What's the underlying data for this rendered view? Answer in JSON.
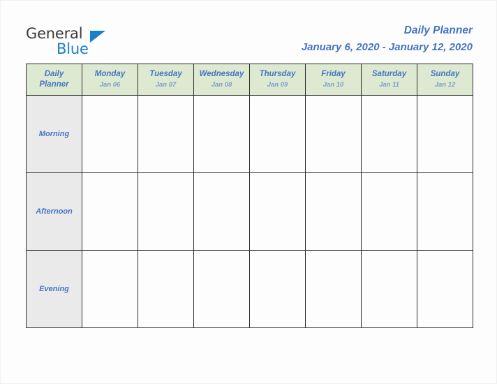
{
  "brand": {
    "line1": "General",
    "line2": "Blue",
    "triangle_icon": "blue-triangle-icon",
    "colors": {
      "text": "#3b3b3b",
      "accent": "#1a7fc8"
    }
  },
  "header": {
    "title": "Daily Planner",
    "date_range": "January 6, 2020 - January 12, 2020",
    "color": "#4574C4"
  },
  "planner": {
    "corner_label_line1": "Daily",
    "corner_label_line2": "Planner",
    "header_bg": "#dde9d0",
    "row_label_bg": "#eaeaea",
    "border_color": "#2b2b2b",
    "columns": [
      {
        "day": "Monday",
        "date": "Jan 06"
      },
      {
        "day": "Tuesday",
        "date": "Jan 07"
      },
      {
        "day": "Wednesday",
        "date": "Jan 08"
      },
      {
        "day": "Thursday",
        "date": "Jan 09"
      },
      {
        "day": "Friday",
        "date": "Jan 10"
      },
      {
        "day": "Saturday",
        "date": "Jan 11"
      },
      {
        "day": "Sunday",
        "date": "Jan 12"
      }
    ],
    "rows": [
      {
        "label": "Morning",
        "cells": [
          "",
          "",
          "",
          "",
          "",
          "",
          ""
        ]
      },
      {
        "label": "Afternoon",
        "cells": [
          "",
          "",
          "",
          "",
          "",
          "",
          ""
        ]
      },
      {
        "label": "Evening",
        "cells": [
          "",
          "",
          "",
          "",
          "",
          "",
          ""
        ]
      }
    ]
  }
}
